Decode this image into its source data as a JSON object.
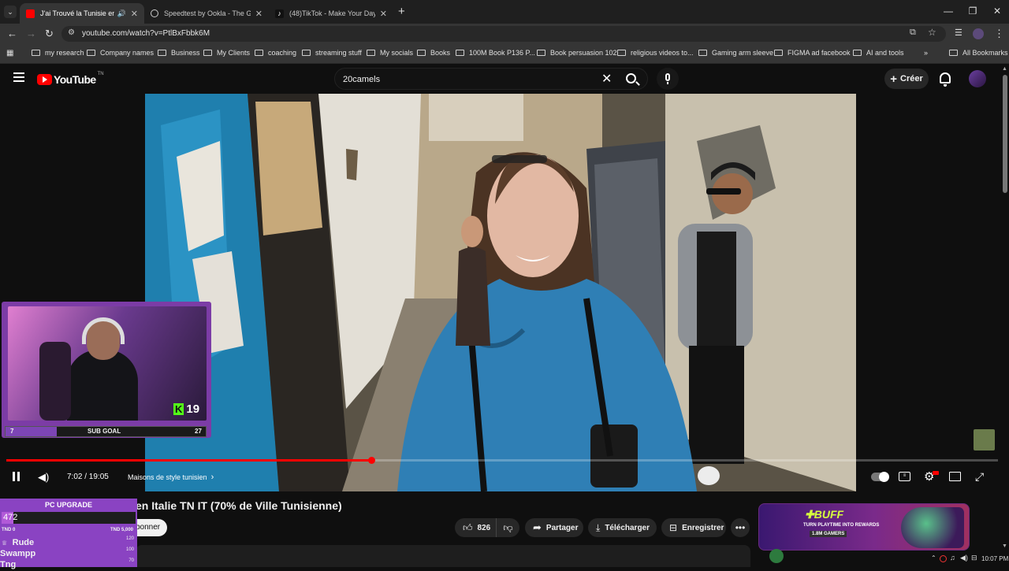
{
  "browser": {
    "tabs": [
      {
        "title": "J'ai Trouvé la Tunisie en Itali",
        "active": true,
        "favicon": "youtube-favicon"
      },
      {
        "title": "Speedtest by Ookla - The Glob",
        "active": false,
        "favicon": "speedtest-favicon"
      },
      {
        "title": "(48)TikTok - Make Your Day",
        "active": false,
        "favicon": "tiktok-favicon"
      }
    ],
    "url": "youtube.com/watch?v=PtlBxFbbk6M",
    "bookmarks": [
      "my research",
      "Company names",
      "Business",
      "My Clients",
      "coaching",
      "streaming stuff",
      "My socials",
      "Books",
      "100M Book P136 P...",
      "Book persuasion 102",
      "religious videos to...",
      "Gaming arm sleeve",
      "FIGMA ad facebook",
      "AI and tools"
    ],
    "all_bookmarks": "All Bookmarks"
  },
  "youtube": {
    "logo": "YouTube",
    "logo_sup": "TN",
    "search_value": "20camels",
    "create_label": "Créer",
    "accent": "#ff0000"
  },
  "player": {
    "time": "7:02 / 19:05",
    "chapter": "Maisons de style tunisien",
    "progress": 0.368
  },
  "video_info": {
    "title_visible": "en Italie TN IT (70% de Ville Tunisienne)",
    "subscribe_partial": "bonner",
    "likes": "826",
    "share": "Partager",
    "download": "Télécharger",
    "save": "Enregistrer"
  },
  "ad": {
    "brand": "BUFF",
    "line1": "TURN PLAYTIME INTO REWARDS",
    "line2": "1.8M GAMERS"
  },
  "stream_overlay": {
    "sub_goal_label": "SUB GOAL",
    "sub_goal_current": "7",
    "sub_goal_target": "27",
    "kick_count": "19",
    "pc_upgrade_label": "PC UPGRADE",
    "pc_upgrade_value": "472",
    "pc_upgrade_min": "TND 0",
    "pc_upgrade_max": "TND 5,000",
    "leaderboard": [
      {
        "name": "Rude",
        "score": "120"
      },
      {
        "name": "Swampp",
        "score": "100"
      },
      {
        "name": "Tng",
        "score": "70"
      }
    ]
  },
  "taskbar": {
    "clock": "10:07 PM"
  }
}
